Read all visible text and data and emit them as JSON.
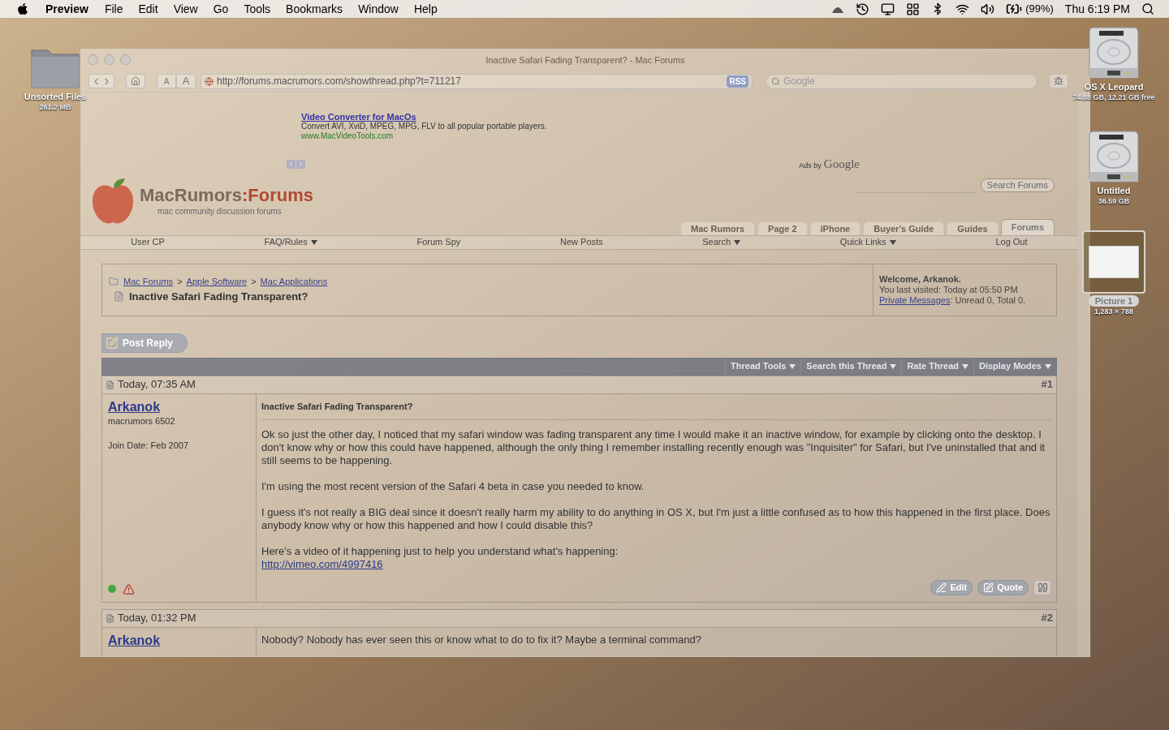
{
  "menu_bar": {
    "app": "Preview",
    "menus": [
      "File",
      "Edit",
      "View",
      "Go",
      "Tools",
      "Bookmarks",
      "Window",
      "Help"
    ],
    "battery": "(99%)",
    "clock": "Thu 6:19 PM"
  },
  "desktop_icons": [
    {
      "kind": "folder",
      "label": "Unsorted Files",
      "detail": "261.2 MB",
      "selected": false
    },
    {
      "kind": "disk",
      "label": "OS X Leopard",
      "detail": "74.88 GB, 12.21 GB free",
      "selected": false
    },
    {
      "kind": "disk",
      "label": "Untitled",
      "detail": "36.59 GB",
      "selected": false
    },
    {
      "kind": "picture",
      "label": "Picture 1",
      "detail": "1,283 × 788",
      "selected": true
    }
  ],
  "browser": {
    "title": "Inactive Safari Fading Transparent? - Mac Forums",
    "font_buttons": [
      "A",
      "A"
    ],
    "url": "http://forums.macrumors.com/showthread.php?t=711217",
    "rss": "RSS",
    "search_placeholder": "Google"
  },
  "ad": {
    "title": "Video Converter for MacOs",
    "text": "Convert AVI, XviD, MPEG, MPG, FLV to all popular portable players.",
    "url": "www.MacVideoTools.com",
    "ads_by": "Ads by",
    "google": "Google"
  },
  "site": {
    "logo_main": "MacRumors",
    "logo_colon": ":",
    "logo_forums": "Forums",
    "tagline": "mac community discussion forums",
    "search_button": "Search Forums",
    "tabs": [
      {
        "label": "Mac Rumors",
        "selected": false
      },
      {
        "label": "Page 2",
        "selected": false
      },
      {
        "label": "iPhone",
        "selected": false
      },
      {
        "label": "Buyer's Guide",
        "selected": false
      },
      {
        "label": "Guides",
        "selected": false
      },
      {
        "label": "Forums",
        "selected": true
      }
    ],
    "nav": [
      {
        "label": "User CP",
        "dropdown": false
      },
      {
        "label": "FAQ/Rules",
        "dropdown": true
      },
      {
        "label": "Forum Spy",
        "dropdown": false
      },
      {
        "label": "New Posts",
        "dropdown": false
      },
      {
        "label": "Search",
        "dropdown": true
      },
      {
        "label": "Quick Links",
        "dropdown": true
      },
      {
        "label": "Log Out",
        "dropdown": false
      }
    ]
  },
  "breadcrumb": {
    "items": [
      "Mac Forums",
      "Apple Software",
      "Mac Applications"
    ],
    "separator": ">",
    "title": "Inactive Safari Fading Transparent?"
  },
  "welcome": {
    "heading": "Welcome, Arkanok.",
    "last_visited": "You last visited: Today at 05:50 PM",
    "pm_link": "Private Messages",
    "pm_text": ": Unread 0, Total 0."
  },
  "post_reply": "Post Reply",
  "thread_tools": [
    "Thread Tools",
    "Search this Thread",
    "Rate Thread",
    "Display Modes"
  ],
  "posts": [
    {
      "date": "Today, 07:35 AM",
      "number": "#1",
      "author": "Arkanok",
      "user_title": "macrumors 6502",
      "join_date": "Join Date: Feb 2007",
      "online": true,
      "subject": "Inactive Safari Fading Transparent?",
      "paragraphs": [
        "Ok so just the other day, I noticed that my safari window was fading transparent any time I would make it an inactive window, for example by clicking onto the desktop. I don't know why or how this could have happened, although the only thing I remember installing recently enough was \"Inquisiter\" for Safari, but I've uninstalled that and it still seems to be happening.",
        "I'm using the most recent version of the Safari 4 beta in case you needed to know.",
        "I guess it's not really a BIG deal since it doesn't really harm my ability to do anything in OS X, but I'm just a little confused as to how this happened in the first place. Does anybody know why or how this happened and how I could disable this?",
        "Here's a video of it happening just to help you understand what's happening:"
      ],
      "link": "http://vimeo.com/4997416",
      "buttons": [
        "Edit",
        "Quote"
      ]
    },
    {
      "date": "Today, 01:32 PM",
      "number": "#2",
      "author": "Arkanok",
      "paragraphs": [
        "Nobody? Nobody has ever seen this or know what to do to fix it? Maybe a terminal command?"
      ]
    }
  ]
}
